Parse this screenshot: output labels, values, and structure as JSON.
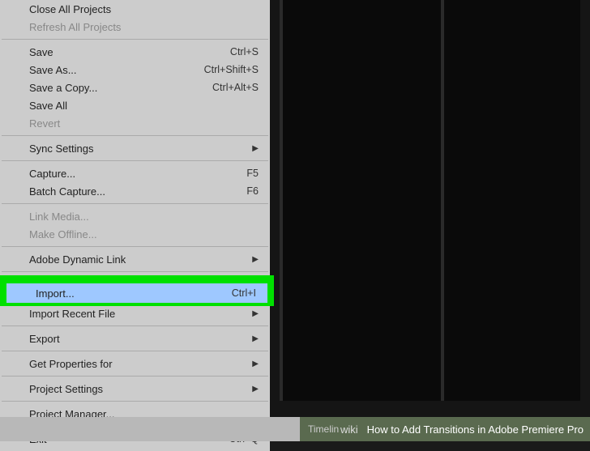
{
  "menu": {
    "items": [
      {
        "label": "Close All Projects",
        "shortcut": "",
        "submenu": false,
        "disabled": false
      },
      {
        "label": "Refresh All Projects",
        "shortcut": "",
        "submenu": false,
        "disabled": true
      },
      {
        "sep": true
      },
      {
        "label": "Save",
        "shortcut": "Ctrl+S",
        "submenu": false,
        "disabled": false
      },
      {
        "label": "Save As...",
        "shortcut": "Ctrl+Shift+S",
        "submenu": false,
        "disabled": false
      },
      {
        "label": "Save a Copy...",
        "shortcut": "Ctrl+Alt+S",
        "submenu": false,
        "disabled": false
      },
      {
        "label": "Save All",
        "shortcut": "",
        "submenu": false,
        "disabled": false
      },
      {
        "label": "Revert",
        "shortcut": "",
        "submenu": false,
        "disabled": true
      },
      {
        "sep": true
      },
      {
        "label": "Sync Settings",
        "shortcut": "",
        "submenu": true,
        "disabled": false
      },
      {
        "sep": true
      },
      {
        "label": "Capture...",
        "shortcut": "F5",
        "submenu": false,
        "disabled": false
      },
      {
        "label": "Batch Capture...",
        "shortcut": "F6",
        "submenu": false,
        "disabled": false
      },
      {
        "sep": true
      },
      {
        "label": "Link Media...",
        "shortcut": "",
        "submenu": false,
        "disabled": true
      },
      {
        "label": "Make Offline...",
        "shortcut": "",
        "submenu": false,
        "disabled": true
      },
      {
        "sep": true
      },
      {
        "label": "Adobe Dynamic Link",
        "shortcut": "",
        "submenu": true,
        "disabled": false
      },
      {
        "sep": true
      },
      {
        "label": "Import...",
        "shortcut": "Ctrl+I",
        "submenu": false,
        "disabled": false,
        "highlighted": true
      },
      {
        "label": "Import Recent File",
        "shortcut": "",
        "submenu": true,
        "disabled": false,
        "under_highlight": true
      },
      {
        "sep": true
      },
      {
        "label": "Export",
        "shortcut": "",
        "submenu": true,
        "disabled": false
      },
      {
        "sep": true
      },
      {
        "label": "Get Properties for",
        "shortcut": "",
        "submenu": true,
        "disabled": false
      },
      {
        "sep": true
      },
      {
        "label": "Project Settings",
        "shortcut": "",
        "submenu": true,
        "disabled": false
      },
      {
        "sep": true
      },
      {
        "label": "Project Manager...",
        "shortcut": "",
        "submenu": false,
        "disabled": false
      },
      {
        "sep": true
      },
      {
        "label": "Exit",
        "shortcut": "Ctrl+Q",
        "submenu": false,
        "disabled": false
      }
    ]
  },
  "footer": {
    "timeline": "Timelin",
    "wiki_prefix": "wiki",
    "caption": "How to Add Transitions in Adobe Premiere Pro"
  }
}
